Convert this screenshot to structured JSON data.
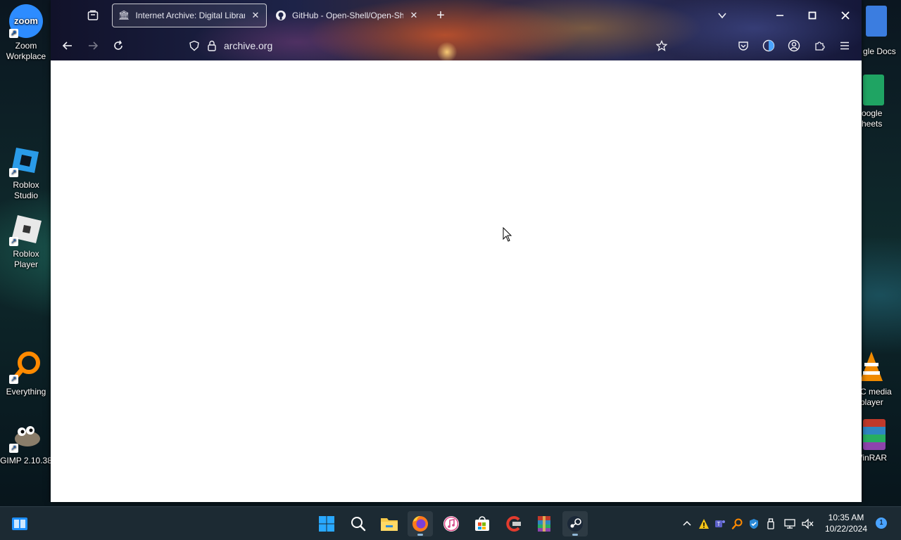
{
  "desktop": {
    "left_icons": [
      {
        "label": "Zoom\nWorkplace",
        "icon": "zoom-icon"
      },
      {
        "label": "Roblox\nStudio",
        "icon": "roblox-studio-icon"
      },
      {
        "label": "Roblox\nPlayer",
        "icon": "roblox-player-icon"
      },
      {
        "label": "Everything",
        "icon": "everything-search-icon"
      },
      {
        "label": "GIMP 2.10.38",
        "icon": "gimp-icon"
      }
    ],
    "right_icons": [
      {
        "label": "gle Docs",
        "icon": "google-docs-icon"
      },
      {
        "label": "oogle\nheets",
        "icon": "google-sheets-icon"
      },
      {
        "label": "C media\nplayer",
        "icon": "vlc-icon"
      },
      {
        "label": "/inRAR",
        "icon": "winrar-icon"
      }
    ]
  },
  "browser": {
    "tabs": [
      {
        "title": "Internet Archive: Digital Library",
        "icon": "internet-archive-icon",
        "active": true
      },
      {
        "title": "GitHub - Open-Shell/Open-She",
        "icon": "github-icon",
        "active": false
      }
    ],
    "url": "archive.org",
    "accent": "#ffffff"
  },
  "taskbar": {
    "pinned": [
      "start-icon",
      "windows-start-icon",
      "search-icon",
      "file-explorer-icon",
      "firefox-icon",
      "itunes-icon",
      "microsoft-store-icon",
      "ccleaner-icon",
      "winrar-icon",
      "steam-icon"
    ],
    "clock": {
      "time": "10:35 AM",
      "date": "10/22/2024"
    },
    "notification_count": "1"
  }
}
